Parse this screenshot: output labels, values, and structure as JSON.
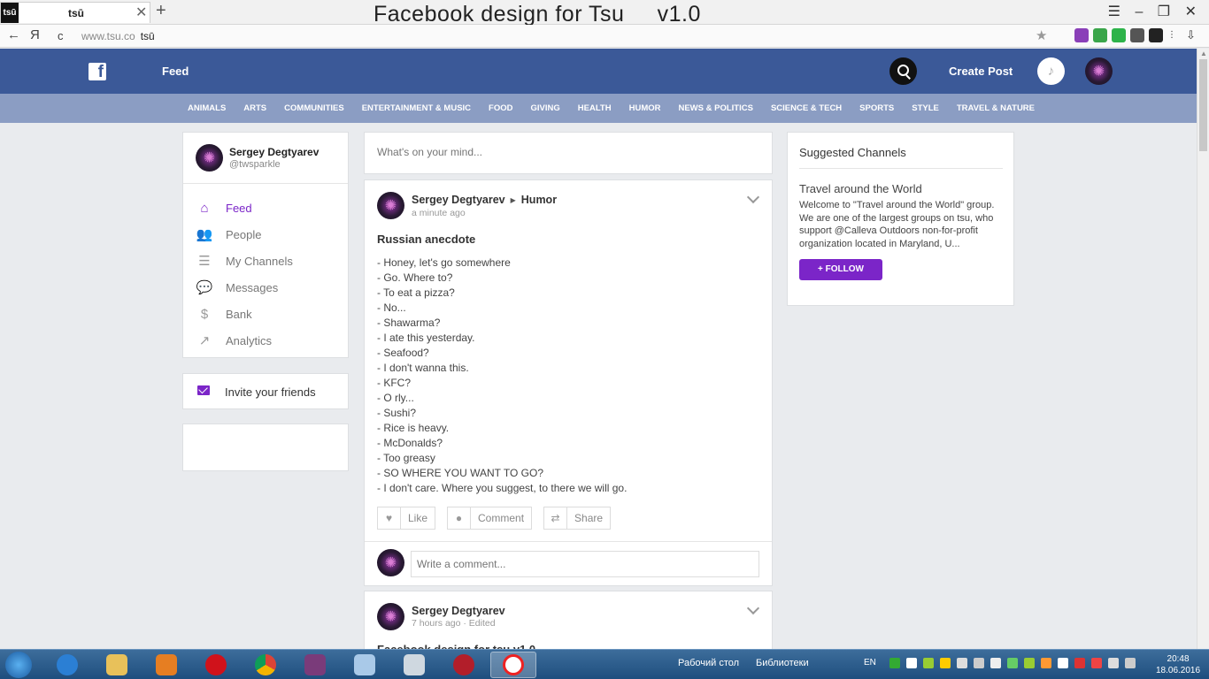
{
  "browser": {
    "tab_favicon": "tsū",
    "tab_title": "tsū",
    "tab_close": "✕",
    "new_tab": "+",
    "window_title": "Facebook design for Tsu     v1.0",
    "window_controls": "☰ ‒ ❐ ✕",
    "back": "←",
    "yandex_btn": "Я",
    "reload": "c",
    "url_domain": "www.tsu.co",
    "url_title": "tsū",
    "bookmark_star": "★",
    "download": "⇩"
  },
  "header": {
    "logo": "f",
    "feed_label": "Feed",
    "create_post_label": "Create Post",
    "bell_icon": "🔔"
  },
  "categories": [
    "ANIMALS",
    "ARTS",
    "COMMUNITIES",
    "ENTERTAINMENT & MUSIC",
    "FOOD",
    "GIVING",
    "HEALTH",
    "HUMOR",
    "NEWS & POLITICS",
    "SCIENCE & TECH",
    "SPORTS",
    "STYLE",
    "TRAVEL & NATURE"
  ],
  "profile": {
    "name": "Sergey Degtyarev",
    "handle": "@twsparkle"
  },
  "menu": [
    {
      "label": "Feed",
      "icon": "home-icon",
      "glyph": "⌂",
      "active": true
    },
    {
      "label": "People",
      "icon": "people-icon",
      "glyph": "👥",
      "active": false
    },
    {
      "label": "My Channels",
      "icon": "list-icon",
      "glyph": "☰",
      "active": false
    },
    {
      "label": "Messages",
      "icon": "messages-icon",
      "glyph": "💬",
      "active": false
    },
    {
      "label": "Bank",
      "icon": "dollar-icon",
      "glyph": "$",
      "active": false
    },
    {
      "label": "Analytics",
      "icon": "trend-icon",
      "glyph": "↗",
      "active": false
    }
  ],
  "invite_label": "Invite your friends",
  "composer_placeholder": "What's on your mind...",
  "post": {
    "author": "Sergey Degtyarev",
    "channel": "Humor",
    "time": "a minute ago",
    "title": "Russian anecdote",
    "lines": [
      "- Honey, let's go somewhere",
      "- Go. Where to?",
      "- To eat a pizza?",
      "- No...",
      "- Shawarma?",
      "- I ate this yesterday.",
      "- Seafood?",
      "- I don't wanna this.",
      "- KFC?",
      "- O rly...",
      "- Sushi?",
      "- Rice is heavy.",
      "- McDonalds?",
      "- Too greasy",
      "- SO WHERE YOU WANT TO GO?",
      "- I don't care. Where you suggest, to there we will go."
    ],
    "like_label": "Like",
    "comment_label": "Comment",
    "share_label": "Share",
    "comment_placeholder": "Write a comment..."
  },
  "post2": {
    "author": "Sergey Degtyarev",
    "time": "7 hours ago · Edited",
    "title": "Facebook design for tsu v1.0"
  },
  "suggested": {
    "heading": "Suggested Channels",
    "channel_name": "Travel around the World",
    "description": "Welcome to \"Travel around the World\" group. We are one of the largest groups on tsu, who support @Calleva Outdoors non-for-profit organization located in Maryland, U...",
    "follow_label": "+ FOLLOW"
  },
  "taskbar": {
    "desktop_label": "Рабочий стол",
    "libraries_label": "Библиотеки",
    "lang": "EN",
    "time": "20:48",
    "date": "18.06.2016"
  },
  "colors": {
    "header_blue": "#3b5998",
    "category_bar": "#8b9dc3",
    "accent_purple": "#7b25c8"
  }
}
